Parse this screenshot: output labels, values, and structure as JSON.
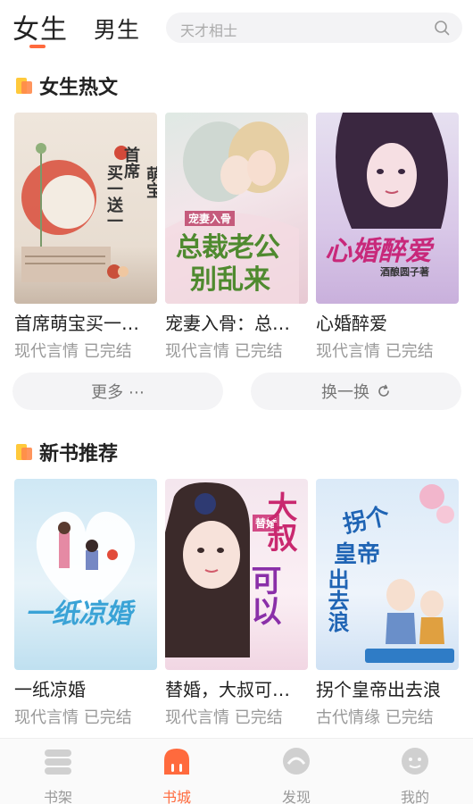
{
  "header": {
    "tab_girl": "女生",
    "tab_boy": "男生",
    "search_placeholder": "天才相士"
  },
  "section_hot": {
    "title": "女生热文",
    "books": [
      {
        "title": "首席萌宝买一…",
        "category": "现代言情",
        "status": "已完结",
        "cover_text": [
          "首席",
          "萌宝",
          "买一送一"
        ]
      },
      {
        "title": "宠妻入骨：总…",
        "category": "现代言情",
        "status": "已完结",
        "cover_text": [
          "宠妻入骨",
          "总裁老公",
          "别乱来"
        ]
      },
      {
        "title": "心婚醉爱",
        "category": "现代言情",
        "status": "已完结",
        "cover_text": [
          "心婚醉爱",
          "酒酿圆子著"
        ]
      }
    ],
    "more_label": "更多 ⋯",
    "refresh_label": "换一换"
  },
  "section_new": {
    "title": "新书推荐",
    "books": [
      {
        "title": "一纸凉婚",
        "category": "现代言情",
        "status": "已完结",
        "cover_text": [
          "一纸凉婚"
        ]
      },
      {
        "title": "替婚，大叔可…",
        "category": "现代言情",
        "status": "已完结",
        "cover_text": [
          "大叔",
          "可以",
          "替婚"
        ]
      },
      {
        "title": "拐个皇帝出去浪",
        "category": "古代情缘",
        "status": "已完结",
        "cover_text": [
          "拐个",
          "皇帝",
          "出去浪"
        ]
      }
    ]
  },
  "nav": {
    "items": [
      {
        "label": "书架",
        "icon": "bookshelf-icon",
        "active": false
      },
      {
        "label": "书城",
        "icon": "bookstore-icon",
        "active": true
      },
      {
        "label": "发现",
        "icon": "discover-icon",
        "active": false
      },
      {
        "label": "我的",
        "icon": "profile-icon",
        "active": false
      }
    ]
  },
  "colors": {
    "accent": "#ff6a3d",
    "muted": "#999999"
  }
}
